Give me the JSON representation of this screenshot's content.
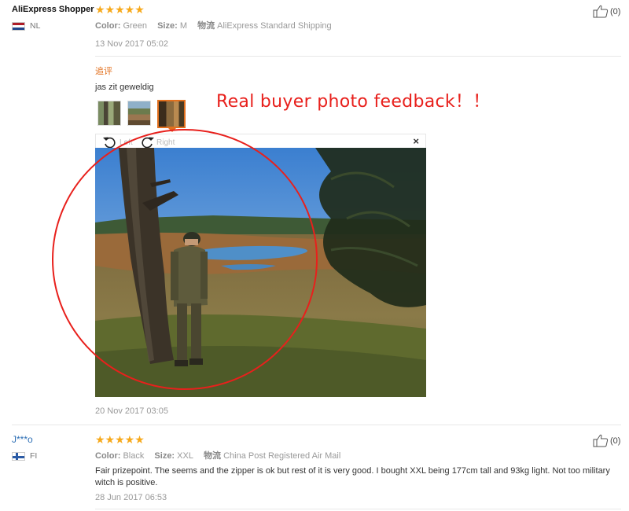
{
  "colors": {
    "accent_orange": "#e2701e",
    "star": "#f7a91b",
    "link_blue": "#2d6fb5",
    "annotation_red": "#e8201c"
  },
  "review1": {
    "buyer": "AliExpress Shopper",
    "country": "NL",
    "flag_icon": "netherlands-flag",
    "stars": "★★★★★",
    "rating": 5,
    "color_label": "Color:",
    "color_value": "Green",
    "size_label": "Size:",
    "size_value": "M",
    "logistics_label": "物流",
    "logistics_value": "AliExpress Standard Shipping",
    "date": "13 Nov 2017 05:02",
    "likes": "(0)",
    "additional_label": "追评",
    "additional_text": "jas zit geweldig",
    "viewer": {
      "rotate_left": "Left",
      "rotate_right": "Right",
      "close": "×"
    },
    "additional_date": "20 Nov 2017 03:05"
  },
  "annotation": {
    "text": "Real buyer photo feedback！！"
  },
  "review2": {
    "buyer": "J***o",
    "country": "FI",
    "flag_icon": "finland-flag",
    "stars": "★★★★★",
    "rating": 5,
    "color_label": "Color:",
    "color_value": "Black",
    "size_label": "Size:",
    "size_value": "XXL",
    "logistics_label": "物流",
    "logistics_value": "China Post Registered Air Mail",
    "text": "Fair prizepoint. The seems and the zipper is ok but rest of it is very good. I bought XXL being 177cm tall and 93kg light. Not too military witch is positive.",
    "date": "28 Jun 2017 06:53",
    "likes": "(0)"
  }
}
